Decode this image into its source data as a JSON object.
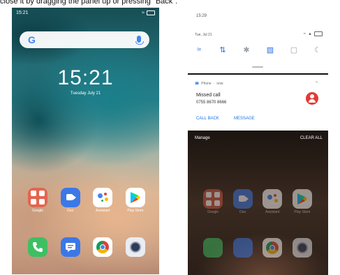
{
  "caption": "close it by dragging the panel up or pressing \"Back\".",
  "home": {
    "status_time": "15:21",
    "clock_time": "15:21",
    "date": "Tuesday  July 21",
    "search_logo": "G",
    "apps": [
      {
        "label": "Google",
        "icon": "google-folder-icon"
      },
      {
        "label": "Duo",
        "icon": "duo-icon"
      },
      {
        "label": "Assistant",
        "icon": "assistant-icon"
      },
      {
        "label": "Play Store",
        "icon": "play-store-icon"
      }
    ],
    "dock": [
      {
        "icon": "phone-icon"
      },
      {
        "icon": "messages-icon"
      },
      {
        "icon": "chrome-icon"
      },
      {
        "icon": "camera-icon"
      }
    ]
  },
  "shade": {
    "time": "15:29",
    "date": "Tue, Jul 21",
    "quick_settings": [
      "wifi-icon",
      "data-icon",
      "bluetooth-icon",
      "vibrate-icon",
      "screen-record-icon",
      "dark-mode-icon"
    ],
    "notification": {
      "app": "Phone",
      "time": "now",
      "title": "Missed call",
      "number": "0755 8670 8666",
      "action_call_back": "CALL BACK",
      "action_message": "MESSAGE"
    },
    "manage_label": "Manage",
    "clear_all_label": "CLEAR ALL",
    "apps": [
      {
        "label": "Google"
      },
      {
        "label": "Duo"
      },
      {
        "label": "Assistant"
      },
      {
        "label": "Play Store"
      }
    ]
  },
  "colors": {
    "accent_blue": "#1a73e8",
    "missed_call_red": "#e53935"
  }
}
